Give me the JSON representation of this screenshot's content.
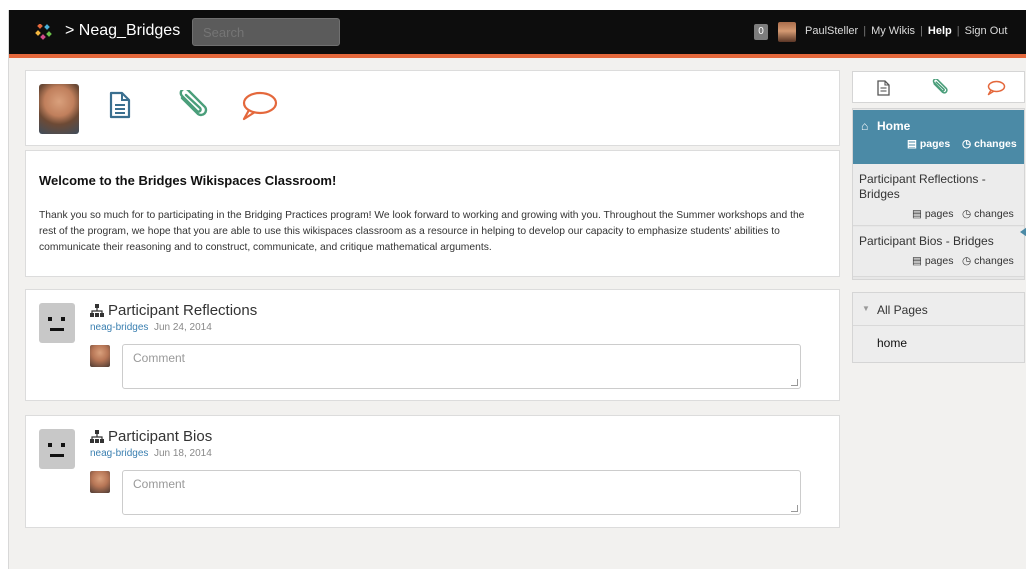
{
  "topbar": {
    "brand": "Neag_Bridges",
    "search_placeholder": "Search",
    "notification_count": "0",
    "username": "PaulSteller",
    "my_wikis": "My Wikis",
    "help": "Help",
    "sign_out": "Sign Out"
  },
  "welcome": {
    "title": "Welcome to the Bridges Wikispaces Classroom!",
    "body": "Thank you so much for to participating in the Bridging Practices program! We look forward to working and growing with you. Throughout the Summer workshops and the rest of the program, we hope that you are able to use this wikispaces classroom as a resource in helping to develop our capacity to emphasize students' abilities to communicate their reasoning and to construct, communicate, and critique mathematical arguments."
  },
  "posts": [
    {
      "title": "Participant Reflections",
      "author": "neag-bridges",
      "date": "Jun 24, 2014",
      "comment_placeholder": "Comment"
    },
    {
      "title": "Participant Bios",
      "author": "neag-bridges",
      "date": "Jun 18, 2014",
      "comment_placeholder": "Comment"
    }
  ],
  "sidebar": {
    "home": {
      "label": "Home",
      "pages": "pages",
      "changes": "changes"
    },
    "items": [
      {
        "label": "Participant Reflections - Bridges",
        "pages": "pages",
        "changes": "changes"
      },
      {
        "label": "Participant Bios - Bridges",
        "pages": "pages",
        "changes": "changes"
      }
    ],
    "all_pages": {
      "label": "All Pages",
      "items": [
        "home"
      ]
    }
  },
  "colors": {
    "topbar": "#0d0d0d",
    "accent_orange": "#e4683c",
    "home_active": "#4b8aa6",
    "icon_blue": "#3a6f8f",
    "icon_green": "#4a9e7a",
    "icon_orange": "#e4683c"
  },
  "icons": [
    "wikispaces-logo-icon",
    "page-icon",
    "paperclip-icon",
    "speech-bubble-icon",
    "home-icon",
    "sitemap-icon",
    "clock-icon",
    "triangle-down-icon"
  ]
}
